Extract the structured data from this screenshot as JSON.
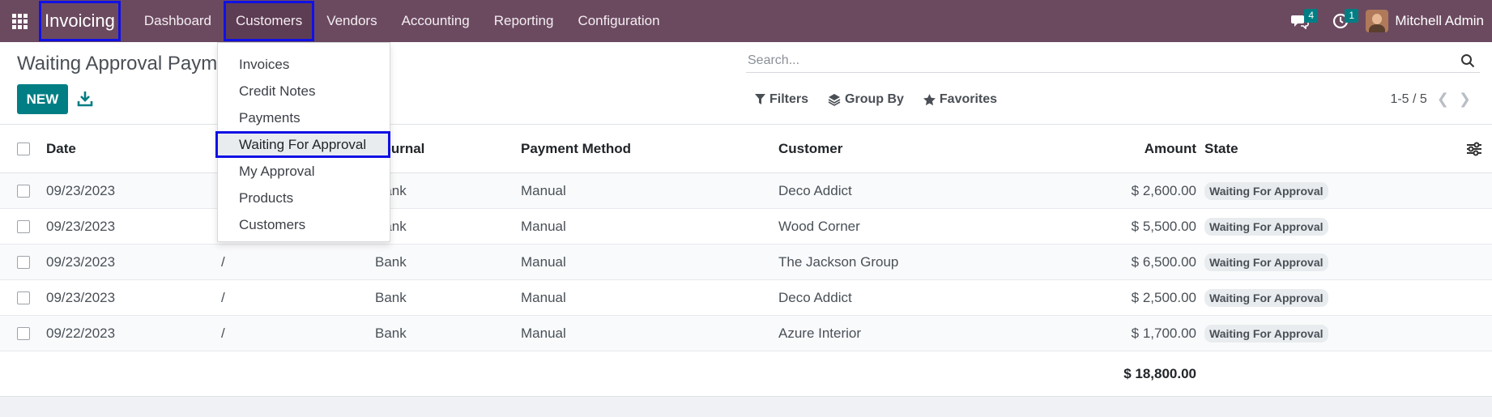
{
  "navbar": {
    "app_name": "Invoicing",
    "menu": [
      "Dashboard",
      "Customers",
      "Vendors",
      "Accounting",
      "Reporting",
      "Configuration"
    ],
    "messages_count": "4",
    "activities_count": "1",
    "user_name": "Mitchell Admin"
  },
  "dropdown": {
    "items": [
      "Invoices",
      "Credit Notes",
      "Payments",
      "Waiting For Approval",
      "My Approval",
      "Products",
      "Customers"
    ]
  },
  "control": {
    "title": "Waiting Approval Payments",
    "new_label": "NEW",
    "search_placeholder": "Search...",
    "filters_label": "Filters",
    "groupby_label": "Group By",
    "favorites_label": "Favorites",
    "pager": "1-5 / 5"
  },
  "table": {
    "headers": {
      "date": "Date",
      "number": "",
      "journal": "Journal",
      "payment_method": "Payment Method",
      "customer": "Customer",
      "amount": "Amount",
      "state": "State"
    },
    "rows": [
      {
        "date": "09/23/2023",
        "number": "/",
        "journal": "Bank",
        "method": "Manual",
        "customer": "Deco Addict",
        "amount": "$ 2,600.00",
        "state": "Waiting For Approval"
      },
      {
        "date": "09/23/2023",
        "number": "/",
        "journal": "Bank",
        "method": "Manual",
        "customer": "Wood Corner",
        "amount": "$ 5,500.00",
        "state": "Waiting For Approval"
      },
      {
        "date": "09/23/2023",
        "number": "/",
        "journal": "Bank",
        "method": "Manual",
        "customer": "The Jackson Group",
        "amount": "$ 6,500.00",
        "state": "Waiting For Approval"
      },
      {
        "date": "09/23/2023",
        "number": "/",
        "journal": "Bank",
        "method": "Manual",
        "customer": "Deco Addict",
        "amount": "$ 2,500.00",
        "state": "Waiting For Approval"
      },
      {
        "date": "09/22/2023",
        "number": "/",
        "journal": "Bank",
        "method": "Manual",
        "customer": "Azure Interior",
        "amount": "$ 1,700.00",
        "state": "Waiting For Approval"
      }
    ],
    "total": "$ 18,800.00"
  },
  "colors": {
    "navbar": "#6b4a60",
    "primary": "#017e84",
    "highlight_box": "#1010e6"
  }
}
